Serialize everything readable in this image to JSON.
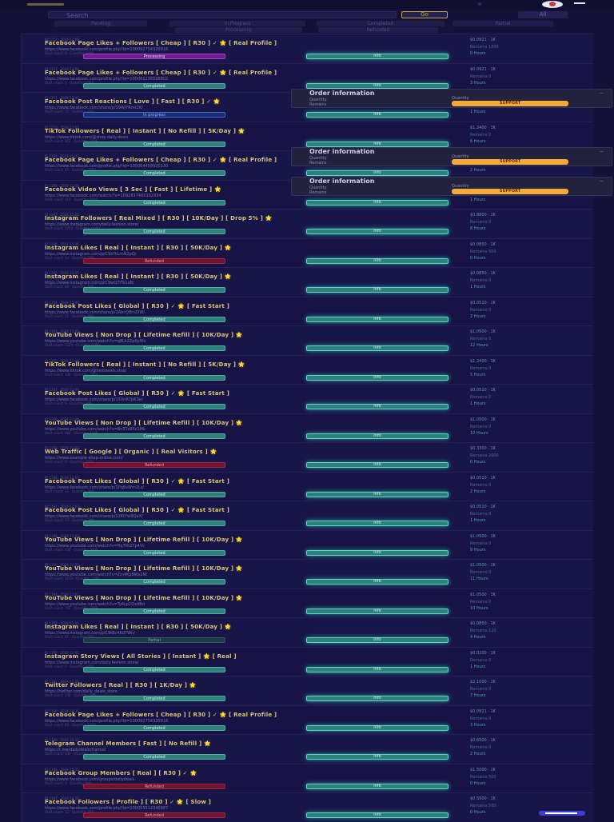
{
  "search": {
    "placeholder": "Search",
    "go_label": "Go",
    "all_label": "All"
  },
  "filters": [
    "Pending",
    "In Progress",
    "Completed",
    "Partial",
    "Processing",
    "Refunded"
  ],
  "panel": {
    "title": "Order information",
    "left1": "Quantity",
    "left2": "Remains",
    "right1": "Quantity",
    "support_label": "SUPPORT"
  },
  "rows": [
    {
      "meta": "ID 1213 · 2024-11-08",
      "title": "Facebook Page Likes + Followers [ Cheap ] [ R30 ] ✓ 🌟 [ Real Profile ]",
      "sub": "https://www.facebook.com/profile.php?id=100092754320918",
      "sub2": "Start count: 0 · Quantity: 1000",
      "status": "Processing",
      "cls": "st-processing",
      "info": "Info",
      "r1": "$0.0921 · 1K",
      "r2": "Remains 1000",
      "r3": "0 Hours"
    },
    {
      "meta": "ID 1212 · 2024-11-08",
      "title": "Facebook Page Likes + Followers [ Cheap ] [ R30 ] ✓ 🌟 [ Real Profile ]",
      "sub": "https://www.facebook.com/profile.php?id=100081236598802",
      "sub2": "Start count: 0 · Quantity: 1000",
      "status": "Completed",
      "cls": "st-completed",
      "info": "Info",
      "r1": "$0.0921 · 1K",
      "r2": "Remains 0",
      "r3": "3 Hours"
    },
    {
      "meta": "ID 1211 · 2024-11-07",
      "title": "Facebook Post Reactions [ Love ] [ Fast ] [ R30 ] ✓ 🌟",
      "sub": "https://www.facebook.com/share/p/19WjYRmt2K/",
      "sub2": "Start count: 12 · Quantity: 500",
      "status": "In progress",
      "cls": "st-inprogress",
      "info": "Info",
      "r1": "$0.0412 · 1K",
      "r2": "Remains 230",
      "r3": "1 Hours",
      "panel": true
    },
    {
      "meta": "ID 1210 · 2024-11-07",
      "title": "TikTok Followers [ Real ] [ Instant ] [ No Refill ] [ 5K/Day ] 🌟",
      "sub": "https://www.tiktok.com/@shop.daily.deals",
      "sub2": "Start count: 802 · Quantity: 2000",
      "status": "Completed",
      "cls": "st-completed",
      "info": "Info",
      "r1": "$1.2400 · 1K",
      "r2": "Remains 0",
      "r3": "6 Hours"
    },
    {
      "meta": "ID 1209 · 2024-11-07",
      "title": "Facebook Page Likes + Followers [ Cheap ] [ R30 ] ✓ 🌟 [ Real Profile ]",
      "sub": "https://www.facebook.com/profile.php?id=100064458920130",
      "sub2": "Start count: 45 · Quantity: 1000",
      "status": "Completed",
      "cls": "st-completed",
      "info": "Info",
      "r1": "$0.0921 · 1K",
      "r2": "Remains 0",
      "r3": "2 Hours",
      "panel": true
    },
    {
      "meta": "ID 1208 · 2024-11-06",
      "title": "Facebook Video Views [ 3 Sec ] [ Fast ] [ Lifetime ] 🌟",
      "sub": "https://www.facebook.com/watch/?v=1092837465102934",
      "sub2": "Start count: 110 · Quantity: 5000",
      "status": "Completed",
      "cls": "st-completed",
      "info": "Info",
      "r1": "$0.0150 · 1K",
      "r2": "Remains 0",
      "r3": "1 Hours",
      "panel": true
    },
    {
      "meta": "ID 1207 · 2024-11-06",
      "title": "Instagram Followers [ Real Mixed ] [ R30 ] [ 10K/Day ] [ Drop 5% ] 🌟",
      "sub": "https://www.instagram.com/daily.fashion.store/",
      "sub2": "Start count: 1203 · Quantity: 1000",
      "status": "Completed",
      "cls": "st-completed",
      "info": "Info",
      "r1": "$0.8800 · 1K",
      "r2": "Remains 0",
      "r3": "8 Hours"
    },
    {
      "meta": "ID 1206 · 2024-11-06",
      "title": "Instagram Likes [ Real ] [ Instant ] [ R30 ] [ 50K/Day ] 🌟",
      "sub": "https://www.instagram.com/p/C9xYkLmN2pQ/",
      "sub2": "Start count: 54 · Quantity: 500",
      "status": "Refunded",
      "cls": "st-refunded",
      "info": "Info",
      "r1": "$0.0850 · 1K",
      "r2": "Remains 500",
      "r3": "0 Hours"
    },
    {
      "meta": "ID 1205 · 2024-11-05",
      "title": "Instagram Likes [ Real ] [ Instant ] [ R30 ] [ 50K/Day ] 🌟",
      "sub": "https://www.instagram.com/p/C9wQ7rTs1aB/",
      "sub2": "Start count: 88 · Quantity: 500",
      "status": "Completed",
      "cls": "st-completed",
      "info": "Info",
      "r1": "$0.0850 · 1K",
      "r2": "Remains 0",
      "r3": "1 Hours"
    },
    {
      "meta": "ID 1204 · 2024-11-05",
      "title": "Facebook Post Likes [ Global ] [ R30 ] ✓ 🌟 [ Fast Start ]",
      "sub": "https://www.facebook.com/share/p/1AbcQ8mZtW/",
      "sub2": "Start count: 21 · Quantity: 300",
      "status": "Completed",
      "cls": "st-completed",
      "info": "Info",
      "r1": "$0.0510 · 1K",
      "r2": "Remains 0",
      "r3": "2 Hours"
    },
    {
      "meta": "ID 1203 · 2024-11-05",
      "title": "YouTube Views [ Non Drop ] [ Lifetime Refill ] [ 10K/Day ] 🌟",
      "sub": "https://www.youtube.com/watch?v=q8Lk2Zp0yWs",
      "sub2": "Start count: 1520 · Quantity: 1000",
      "status": "Completed",
      "cls": "st-completed",
      "info": "Info",
      "r1": "$1.0500 · 1K",
      "r2": "Remains 0",
      "r3": "12 Hours"
    },
    {
      "meta": "ID 1202 · 2024-11-04",
      "title": "TikTok Followers [ Real ] [ Instant ] [ No Refill ] [ 5K/Day ] 🌟",
      "sub": "https://www.tiktok.com/@bestdeals.shop",
      "sub2": "Start count: 340 · Quantity: 1000",
      "status": "Completed",
      "cls": "st-completed",
      "info": "Info",
      "r1": "$1.2400 · 1K",
      "r2": "Remains 0",
      "r3": "5 Hours"
    },
    {
      "meta": "ID 1201 · 2024-11-04",
      "title": "Facebook Post Likes [ Global ] [ R30 ] ✓ 🌟 [ Fast Start ]",
      "sub": "https://www.facebook.com/share/p/15XnR7pK3e/",
      "sub2": "Start count: 9 · Quantity: 300",
      "status": "Completed",
      "cls": "st-completed",
      "info": "Info",
      "r1": "$0.0510 · 1K",
      "r2": "Remains 0",
      "r3": "1 Hours"
    },
    {
      "meta": "ID 1200 · 2024-11-04",
      "title": "YouTube Views [ Non Drop ] [ Lifetime Refill ] [ 10K/Day ] 🌟",
      "sub": "https://www.youtube.com/watch?v=Bn3Tz9Xc1Mk",
      "sub2": "Start count: 980 · Quantity: 1000",
      "status": "Completed",
      "cls": "st-completed",
      "info": "Info",
      "r1": "$1.0500 · 1K",
      "r2": "Remains 0",
      "r3": "10 Hours"
    },
    {
      "meta": "ID 1199 · 2024-11-03",
      "title": "Web Traffic [ Google ] [ Organic ] [ Real Visitors ] 🌟",
      "sub": "https://www.example-shop-online.com/",
      "sub2": "Start count: 0 · Quantity: 2000",
      "status": "Refunded",
      "cls": "st-refunded",
      "info": "Info",
      "r1": "$0.3300 · 1K",
      "r2": "Remains 2000",
      "r3": "0 Hours"
    },
    {
      "meta": "ID 1198 · 2024-11-03",
      "title": "Facebook Post Likes [ Global ] [ R30 ] ✓ 🌟 [ Fast Start ]",
      "sub": "https://www.facebook.com/share/p/1Pq8vWm2Lz/",
      "sub2": "Start count: 33 · Quantity: 300",
      "status": "Completed",
      "cls": "st-completed",
      "info": "Info",
      "r1": "$0.0510 · 1K",
      "r2": "Remains 0",
      "r3": "2 Hours"
    },
    {
      "meta": "ID 1197 · 2024-11-03",
      "title": "Facebook Post Likes [ Global ] [ R30 ] ✓ 🌟 [ Fast Start ]",
      "sub": "https://www.facebook.com/share/p/12KtYw9QaX/",
      "sub2": "Start count: 17 · Quantity: 300",
      "status": "Completed",
      "cls": "st-completed",
      "info": "Info",
      "r1": "$0.0510 · 1K",
      "r2": "Remains 0",
      "r3": "1 Hours"
    },
    {
      "meta": "ID 1196 · 2024-11-02",
      "title": "YouTube Views [ Non Drop ] [ Lifetime Refill ] [ 10K/Day ] 🌟",
      "sub": "https://www.youtube.com/watch?v=Hq7Rt2Yp4Vc",
      "sub2": "Start count: 450 · Quantity: 1000",
      "status": "Completed",
      "cls": "st-completed",
      "info": "Info",
      "r1": "$1.0500 · 1K",
      "r2": "Remains 0",
      "r3": "9 Hours"
    },
    {
      "meta": "ID 1195 · 2024-11-02",
      "title": "YouTube Views [ Non Drop ] [ Lifetime Refill ] [ 10K/Day ] 🌟",
      "sub": "https://www.youtube.com/watch?v=Zm4Kp8Ws2Nt",
      "sub2": "Start count: 1210 · Quantity: 1000",
      "status": "Completed",
      "cls": "st-completed",
      "info": "Info",
      "r1": "$1.0500 · 1K",
      "r2": "Remains 0",
      "r3": "11 Hours"
    },
    {
      "meta": "ID 1194 · 2024-11-02",
      "title": "YouTube Views [ Non Drop ] [ Lifetime Refill ] [ 10K/Day ] 🌟",
      "sub": "https://www.youtube.com/watch?v=Ty6Lp1Qx9Bd",
      "sub2": "Start count: 702 · Quantity: 1000",
      "status": "Completed",
      "cls": "st-completed",
      "info": "Info",
      "r1": "$1.0500 · 1K",
      "r2": "Remains 0",
      "r3": "10 Hours"
    },
    {
      "meta": "ID 1193 · 2024-11-01",
      "title": "Instagram Likes [ Real ] [ Instant ] [ R30 ] [ 50K/Day ] 🌟",
      "sub": "https://www.instagram.com/p/C9tBc4Kd7Wn/",
      "sub2": "Start count: 61 · Quantity: 500",
      "status": "Partial",
      "cls": "st-partial",
      "info": "Info",
      "r1": "$0.0850 · 1K",
      "r2": "Remains 120",
      "r3": "4 Hours"
    },
    {
      "meta": "ID 1192 · 2024-11-01",
      "title": "Instagram Story Views [ All Stories ] [ Instant ] 🌟 [ Real ]",
      "sub": "https://www.instagram.com/daily.fashion.store/",
      "sub2": "Start count: 0 · Quantity: 1000",
      "status": "Completed",
      "cls": "st-completed",
      "info": "Info",
      "r1": "$0.0200 · 1K",
      "r2": "Remains 0",
      "r3": "1 Hours"
    },
    {
      "meta": "ID 1191 · 2024-11-01",
      "title": "Twitter Followers [ Real ] [ R30 ] [ 1K/Day ] 🌟",
      "sub": "https://twitter.com/daily_deals_store",
      "sub2": "Start count: 230 · Quantity: 500",
      "status": "Completed",
      "cls": "st-completed",
      "info": "Info",
      "r1": "$2.1000 · 1K",
      "r2": "Remains 0",
      "r3": "7 Hours"
    },
    {
      "meta": "ID 1190 · 2024-10-31",
      "title": "Facebook Page Likes + Followers [ Cheap ] [ R30 ] ✓ 🌟 [ Real Profile ]",
      "sub": "https://www.facebook.com/profile.php?id=100092754320918",
      "sub2": "Start count: 60 · Quantity: 1000",
      "status": "Completed",
      "cls": "st-completed",
      "info": "Info",
      "r1": "$0.0921 · 1K",
      "r2": "Remains 0",
      "r3": "3 Hours"
    },
    {
      "meta": "ID 1189 · 2024-10-31",
      "title": "Telegram Channel Members [ Fast ] [ No Refill ] 🌟",
      "sub": "https://t.me/dailydealschannel",
      "sub2": "Start count: 140 · Quantity: 1000",
      "status": "Completed",
      "cls": "st-completed",
      "info": "Info",
      "r1": "$0.6500 · 1K",
      "r2": "Remains 0",
      "r3": "2 Hours"
    },
    {
      "meta": "ID 1188 · 2024-10-31",
      "title": "Facebook Group Members [ Real ] [ R30 ] ✓ 🌟",
      "sub": "https://www.facebook.com/groups/dailydeals",
      "sub2": "Start count: 0 · Quantity: 500",
      "status": "Refunded",
      "cls": "st-refunded",
      "info": "Info",
      "r1": "$1.5000 · 1K",
      "r2": "Remains 500",
      "r3": "0 Hours"
    },
    {
      "meta": "ID 1187 · 2024-10-30",
      "title": "Facebook Followers [ Profile ] [ R30 ] ✓ 🌟 [ Slow ]",
      "sub": "https://www.facebook.com/profile.php?id=100055512340987",
      "sub2": "Start count: 12 · Quantity: 500",
      "status": "Refunded",
      "cls": "st-refunded",
      "info": "Info",
      "r1": "$0.5500 · 1K",
      "r2": "Remains 500",
      "r3": "0 Hours"
    }
  ]
}
